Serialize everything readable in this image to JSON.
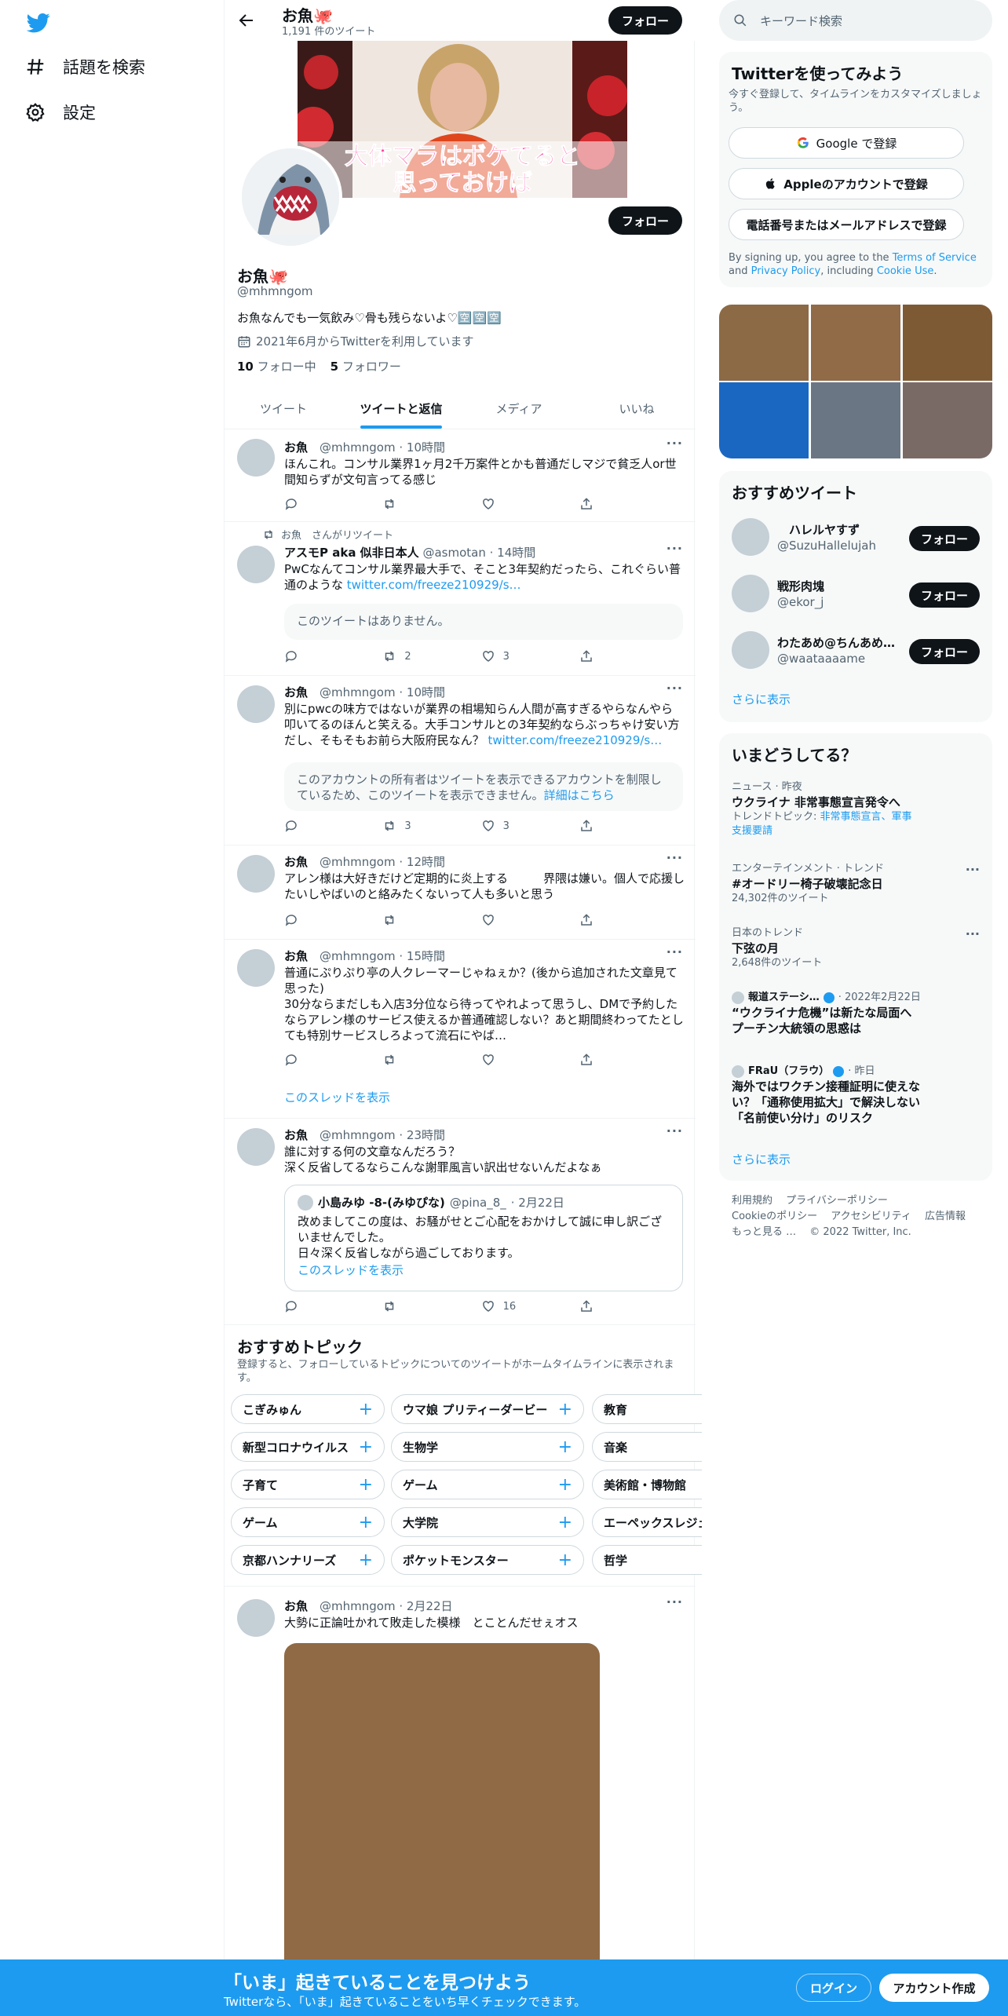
{
  "nav": {
    "explore": "話題を検索",
    "settings": "設定"
  },
  "header": {
    "name": "お魚🐙",
    "tweet_count": "1,191 件のツイート",
    "follow": "フォロー"
  },
  "banner": {
    "caption_line1": "大体マラはボケてると",
    "caption_line2": "思っておけば"
  },
  "profile": {
    "name": "お魚🐙",
    "handle": "@mhmngom",
    "bio": "お魚なんでも一気飲み♡骨も残らないよ♡🈳🈳🈳",
    "joined": "2021年6月からTwitterを利用しています",
    "following_count": "10",
    "following_label": "フォロー中",
    "followers_count": "5",
    "followers_label": "フォロワー",
    "follow": "フォロー"
  },
  "tabs": [
    "ツイート",
    "ツイートと返信",
    "メディア",
    "いいね"
  ],
  "tweets": [
    {
      "name": "お魚",
      "handle": "@mhmngom",
      "time": "· 10時間",
      "text": "ほんこれ。コンサル業界1ヶ月2千万案件とかも普通だしマジで貧乏人or世間知らずが文句言ってる感じ"
    },
    {
      "retweet": "お魚　さんがリツイート",
      "name": "アスモP aka 似非日本人",
      "handle": "@asmotan",
      "time": "· 14時間",
      "text": "PwCなんてコンサル業界最大手で、そこと3年契約だったら、これぐらい普通のような ",
      "link": "twitter.com/freeze210929/s…",
      "quote": "このツイートはありません。",
      "retweets": "2",
      "likes": "3"
    },
    {
      "name": "お魚",
      "handle": "@mhmngom",
      "time": "· 10時間",
      "text": "別にpwcの味方ではないが業界の相場知らん人間が高すぎるやらなんやら叩いてるのほんと笑える。大手コンサルとの3年契約ならぶっちゃけ安い方だし、そもそもお前ら大阪府民なん？ ",
      "link": "twitter.com/freeze210929/s…",
      "quote": "このアカウントの所有者はツイートを表示できるアカウントを制限しているため、このツイートを表示できません。",
      "quote_link": "詳細はこちら",
      "retweets": "3",
      "likes": "3"
    },
    {
      "name": "お魚",
      "handle": "@mhmngom",
      "time": "· 12時間",
      "text": "アレン様は大好きだけど定期的に炎上する　　　界隈は嫌い。個人で応援したいしやばいのと絡みたくないって人も多いと思う"
    },
    {
      "name": "お魚",
      "handle": "@mhmngom",
      "time": "· 15時間",
      "text": "普通にぷりぷり亭の人クレーマーじゃねぇか？(後から追加された文章見て思った)\n30分ならまだしも入店3分位なら待ってやれよって思うし、DMで予約したならアレン様のサービス使えるか普通確認しない？あと期間終わってたとしても特別サービスしろよって流石にやば…",
      "thread": "このスレッドを表示"
    },
    {
      "name": "お魚",
      "handle": "@mhmngom",
      "time": "· 23時間",
      "text": "誰に対する何の文章なんだろう？\n深く反省してるならこんな謝罪風言い訳出せないんだよなぁ",
      "quote_name": "小島みゆ -8-(みゆぴな)",
      "quote_handle": "@pina_8_",
      "quote_time": "· 2月22日",
      "quote_text": "改めましてこの度は、お騒がせとご心配をおかけして誠に申し訳ございませんでした。\n日々深く反省しながら過ごしております。",
      "quote_thread": "このスレッドを表示",
      "likes": "16"
    },
    {
      "name": "お魚",
      "handle": "@mhmngom",
      "time": "· 2月22日",
      "text": "大勢に正論吐かれて敗走した模様　とことんだせぇオス"
    }
  ],
  "topics": {
    "title": "おすすめトピック",
    "subtitle": "登録すると、フォローしているトピックについてのツイートがホームタイムラインに表示されます。",
    "rows": [
      [
        "こぎみゅん",
        "ウマ娘 プリティーダービー",
        "教育"
      ],
      [
        "新型コロナウイルス",
        "生物学",
        "音楽"
      ],
      [
        "子育て",
        "ゲーム",
        "美術館・博物館"
      ],
      [
        "ゲーム",
        "大学院",
        "エーペックスレジェ"
      ],
      [
        "京都ハンナリーズ",
        "ポケットモンスター",
        "哲学"
      ]
    ]
  },
  "search": {
    "placeholder": "キーワード検索"
  },
  "signup": {
    "title": "Twitterを使ってみよう",
    "subtitle": "今すぐ登録して、タイムラインをカスタマイズしましょう。",
    "google": "Google で登録",
    "apple": "Appleのアカウントで登録",
    "phone": "電話番号またはメールアドレスで登録",
    "legal_prefix": "By signing up, you agree to the ",
    "terms": "Terms of Service",
    "and": " and ",
    "privacy": "Privacy Policy",
    "including": ", including ",
    "cookie": "Cookie Use",
    "period": "."
  },
  "photo_colors": [
    "#8b6a45",
    "#916a48",
    "#7e5a34",
    "#1a67c2",
    "#6b7685",
    "#7a6a66"
  ],
  "recommended": {
    "title": "おすすめツイート",
    "users": [
      {
        "name": "　ハレルヤすず",
        "handle": "@SuzuHallelujah"
      },
      {
        "name": "戦形肉塊",
        "handle": "@ekor_j"
      },
      {
        "name": "わたあめ@ちんあめ…",
        "handle": "@waataaaame"
      }
    ],
    "follow": "フォロー",
    "more": "さらに表示"
  },
  "trends": {
    "title": "いまどうしてる？",
    "items": [
      {
        "ctx": "ニュース · 昨夜",
        "title": "ウクライナ 非常事態宣言発令へ",
        "sub_prefix": "トレンドトピック: ",
        "sub_link": "非常事態宣言、軍事支援要請"
      },
      {
        "ctx": "エンターテインメント · トレンド",
        "title": "#オードリー椅子破壊記念日",
        "sub": "24,302件のツイート"
      },
      {
        "ctx": "日本のトレンド",
        "title": "下弦の月",
        "sub": "2,648件のツイート"
      },
      {
        "src": "報道ステーシ…",
        "time": "· 2022年2月22日",
        "title": "“ウクライナ危機”は新たな局面へ プーチン大統領の思惑は"
      },
      {
        "src": "FRaU（フラウ）",
        "time": "· 昨日",
        "title": "海外ではワクチン接種証明に使えない？「通称使用拡大」で解決しない「名前使い分け」のリスク"
      }
    ],
    "more": "さらに表示"
  },
  "footer": {
    "terms": "利用規約",
    "privacy": "プライバシーポリシー",
    "cookie": "Cookieのポリシー",
    "accessibility": "アクセシビリティ",
    "ads": "広告情報",
    "more": "もっと見る …",
    "copyright": "© 2022 Twitter, Inc."
  },
  "bottom_bar": {
    "title": "「いま」起きていることを見つけよう",
    "subtitle": "Twitterなら、「いま」起きていることをいち早くチェックできます。",
    "login": "ログイン",
    "signup": "アカウント作成"
  }
}
